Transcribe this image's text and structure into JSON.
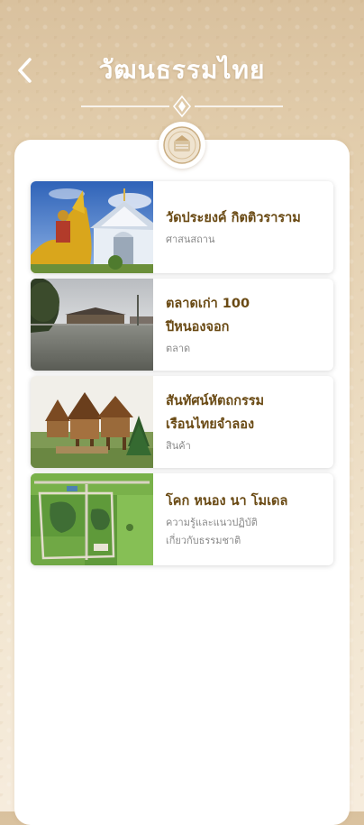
{
  "header": {
    "title": "วัฒนธรรมไทย",
    "back_icon": "chevron-left-icon"
  },
  "colors": {
    "accent_gold": "#6a4a14",
    "background_beige": "#e2cdac"
  },
  "items": [
    {
      "title_lines": [
        "วัดประยงค์ กิตติวราราม"
      ],
      "sub_lines": [
        "ศาสนสถาน"
      ],
      "image": "temple-photo"
    },
    {
      "title_lines": [
        "ตลาดเก่า 100",
        "ปีหนองจอก"
      ],
      "sub_lines": [
        "ตลาด"
      ],
      "image": "old-market-photo"
    },
    {
      "title_lines": [
        "สันทัศน์หัตถกรรม",
        "เรือนไทยจำลอง"
      ],
      "sub_lines": [
        "สินค้า"
      ],
      "image": "thai-house-model-photo"
    },
    {
      "title_lines": [
        "โคก หนอง นา โมเดล"
      ],
      "sub_lines": [
        "ความรู้และแนวปฏิบัติ",
        "เกี่ยวกับธรรมชาติ"
      ],
      "image": "farm-aerial-photo"
    }
  ]
}
